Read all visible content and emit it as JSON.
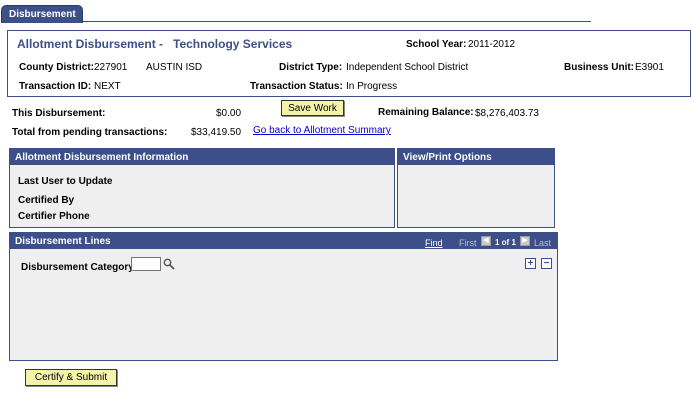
{
  "tab": {
    "label": "Disbursement"
  },
  "header": {
    "title": "Allotment Disbursement -",
    "subtitle": "Technology Services",
    "school_year_label": "School Year:",
    "school_year_value": "2011-2012",
    "county_district_label": "County District:",
    "county_district_value": "227901",
    "district_name": "AUSTIN ISD",
    "district_type_label": "District Type:",
    "district_type_value": "Independent School District",
    "business_unit_label": "Business Unit:",
    "business_unit_value": "E3901",
    "transaction_id_label": "Transaction ID:",
    "transaction_id_value": "NEXT",
    "transaction_status_label": "Transaction Status:",
    "transaction_status_value": "In Progress"
  },
  "summary": {
    "this_disbursement_label": "This Disbursement:",
    "this_disbursement_value": "$0.00",
    "save_work_label": "Save Work",
    "remaining_balance_label": "Remaining Balance:",
    "remaining_balance_value": "$8,276,403.73",
    "pending_label": "Total from pending transactions:",
    "pending_value": "$33,419.50",
    "back_link": "Go back to Allotment Summary"
  },
  "info_section": {
    "title": "Allotment Disbursement Information",
    "last_user_label": "Last User to Update",
    "certified_by_label": "Certified By",
    "certifier_phone_label": "Certifier Phone"
  },
  "view_print": {
    "title": "View/Print Options"
  },
  "lines_section": {
    "title": "Disbursement Lines",
    "find": "Find",
    "first": "First",
    "pager": "1 of 1",
    "last": "Last",
    "category_label": "Disbursement Category",
    "category_value": "",
    "add_symbol": "+",
    "remove_symbol": "−"
  },
  "footer": {
    "certify_label": "Certify & Submit"
  },
  "colors": {
    "accent": "#3c4f89",
    "button_bg": "#f5f2a9",
    "section_bg": "#efefef",
    "link": "#0000cc"
  }
}
